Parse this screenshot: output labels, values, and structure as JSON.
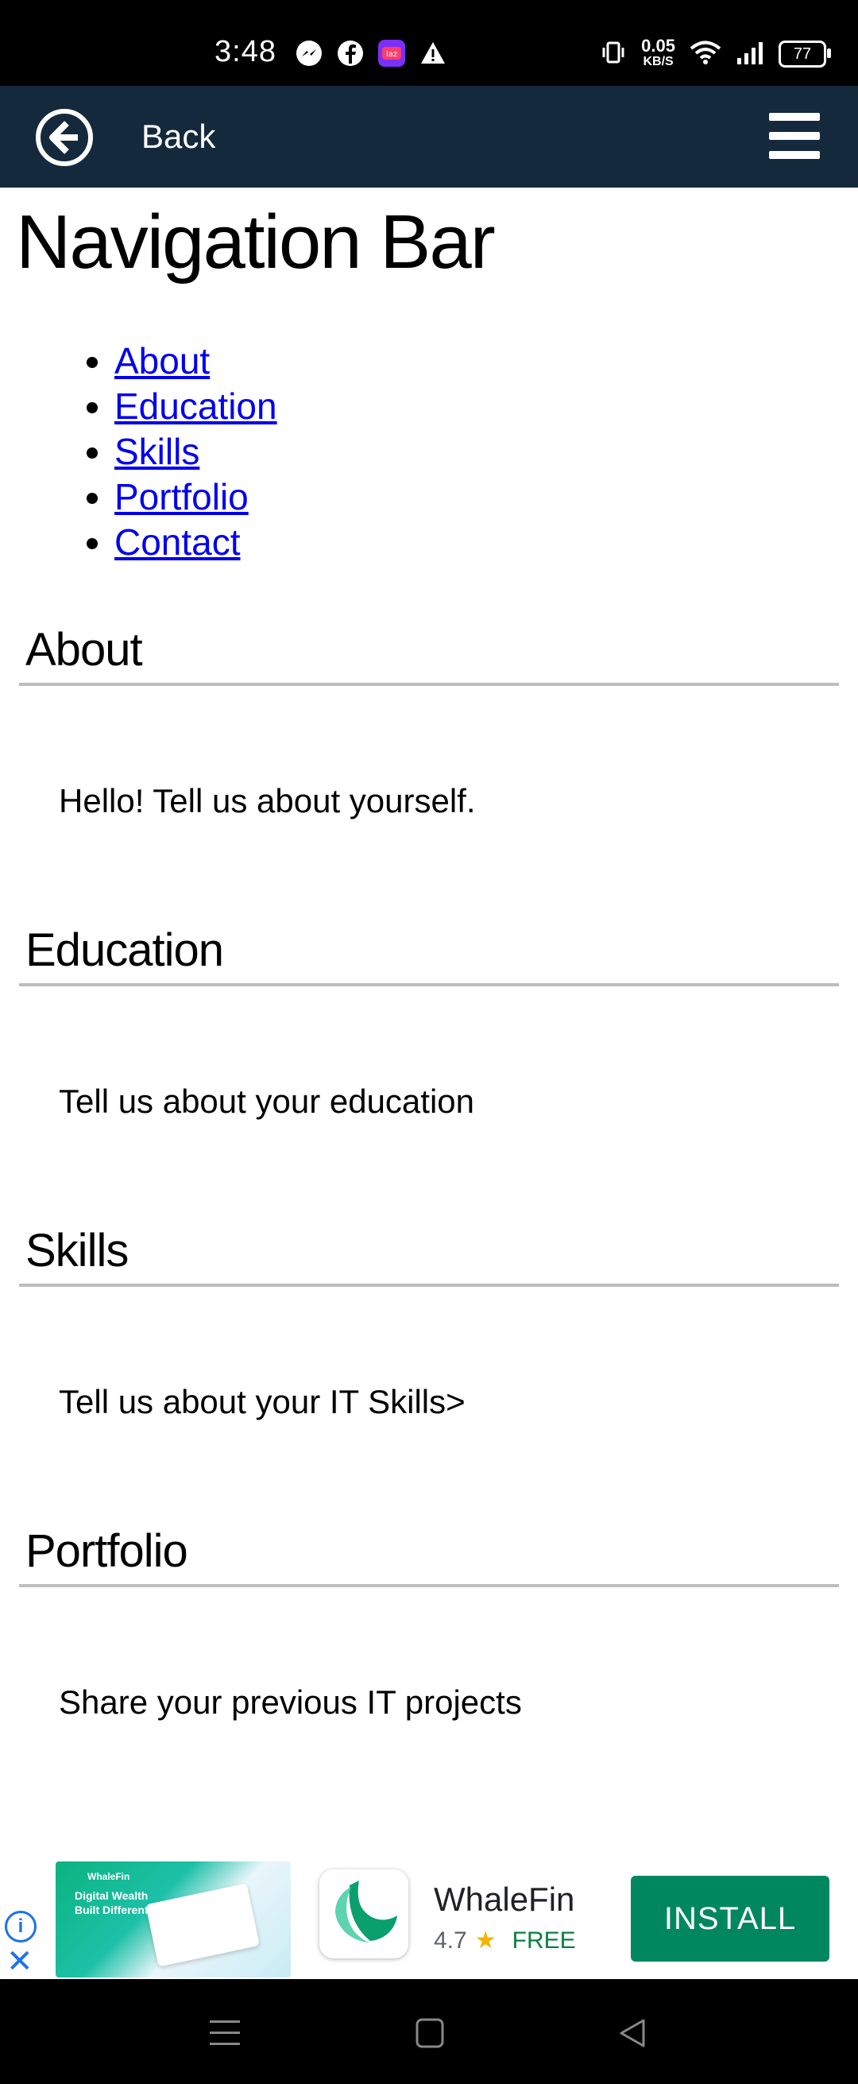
{
  "status_bar": {
    "time": "3:48",
    "net_speed": "0.05",
    "net_unit": "KB/S",
    "battery": "77",
    "icons": [
      "messenger-icon",
      "facebook-icon",
      "lazada-icon",
      "warning-icon",
      "vibrate-icon",
      "wifi-icon",
      "signal-icon",
      "battery-icon"
    ]
  },
  "app_bar": {
    "back_label": "Back",
    "color": "#14293c"
  },
  "page": {
    "title": "Navigation Bar",
    "nav_links": [
      "About",
      "Education",
      "Skills",
      "Portfolio",
      "Contact"
    ],
    "sections": [
      {
        "heading": "About",
        "text": "Hello! Tell us about yourself."
      },
      {
        "heading": "Education",
        "text": "Tell us about your education"
      },
      {
        "heading": "Skills",
        "text": "Tell us about your IT Skills>"
      },
      {
        "heading": "Portfolio",
        "text": "Share your previous IT projects"
      }
    ],
    "link_color": "#0000ee"
  },
  "ad": {
    "banner_brand": "WhaleFin",
    "banner_text": "Digital Wealth Built Different",
    "app_name": "WhaleFin",
    "rating": "4.7",
    "price": "FREE",
    "install_label": "INSTALL",
    "install_color": "#01875f"
  }
}
